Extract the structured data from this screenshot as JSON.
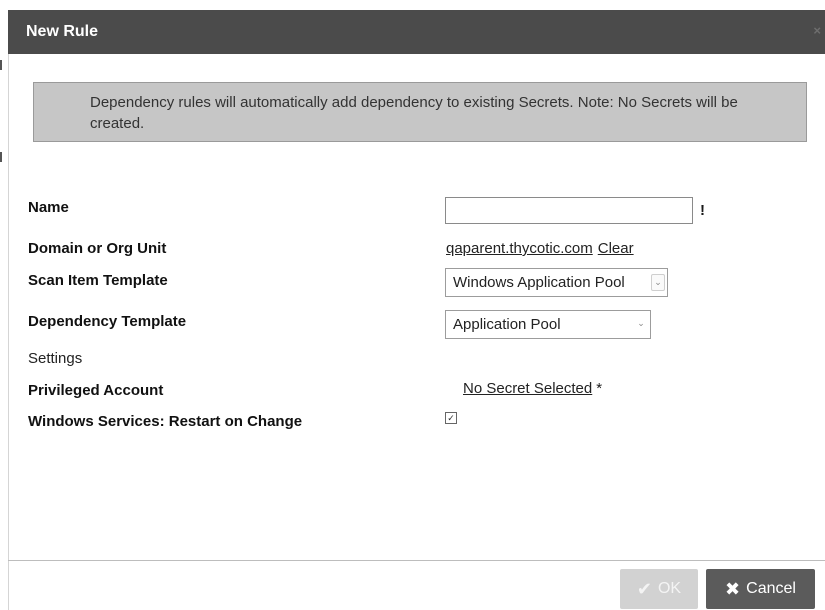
{
  "dialog": {
    "title": "New Rule",
    "close_glyph": "×"
  },
  "notice": {
    "text": "Dependency rules will automatically add dependency to existing Secrets. Note: No Secrets will be created."
  },
  "form": {
    "name": {
      "label": "Name",
      "value": "",
      "required_mark": "!"
    },
    "domain": {
      "label": "Domain or Org Unit",
      "value": "qaparent.thycotic.com",
      "clear_link": "Clear"
    },
    "scan_item_template": {
      "label": "Scan Item Template",
      "selected": "Windows Application Pool"
    },
    "dependency_template": {
      "label": "Dependency Template",
      "selected": "Application Pool"
    },
    "settings_heading": "Settings",
    "privileged_account": {
      "label": "Privileged Account",
      "value": "No Secret Selected",
      "required_mark": "*"
    },
    "restart_on_change": {
      "label": "Windows Services: Restart on Change",
      "checked": true,
      "check_glyph": "✓"
    }
  },
  "footer": {
    "ok_label": "OK",
    "cancel_label": "Cancel",
    "ok_enabled": false
  },
  "icons": {
    "ok": "check-icon",
    "cancel": "x-icon",
    "select_arrow": "chevron-down-icon"
  },
  "colors": {
    "title_bar": "#4b4b4b",
    "notice_bg": "#c6c6c6",
    "cancel_bg": "#5b5b5b",
    "ok_disabled_bg": "#d2d2d2"
  }
}
